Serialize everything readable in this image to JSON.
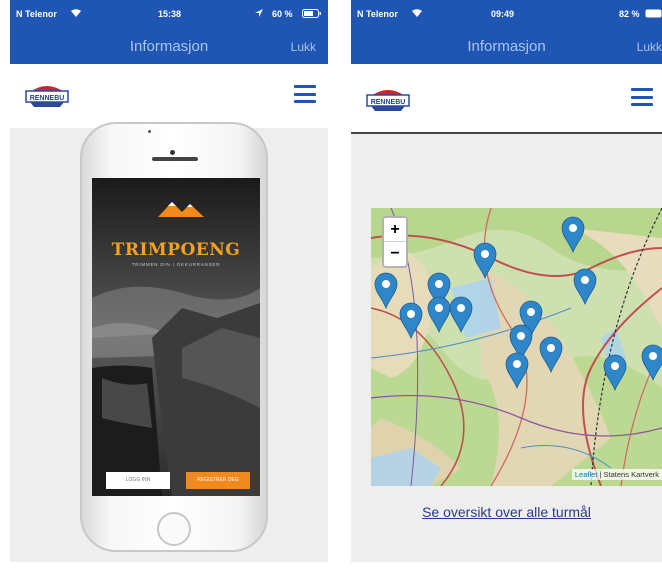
{
  "left": {
    "status": {
      "carrier": "N Telenor",
      "time": "15:38",
      "battery": "60 %"
    },
    "header": {
      "title": "Informasjon",
      "close_label": "Lukk"
    },
    "logo_text": "RENNEBU",
    "app": {
      "title": "TRIMPOENG",
      "subtitle": "TRIMMEN DIN I OKKURRANSER",
      "login_label": "LOGG INN",
      "register_label": "REGISTRER DEG",
      "accent": "#f08a1c"
    }
  },
  "right": {
    "status": {
      "carrier": "N Telenor",
      "time": "09:49",
      "battery": "82 %"
    },
    "header": {
      "title": "Informasjon",
      "close_label": "Lukk"
    },
    "logo_text": "RENNEBU",
    "map": {
      "zoom_in": "+",
      "zoom_out": "−",
      "attribution_leaflet": "Leaflet",
      "attribution_source": "| Statens Kartverk",
      "marker_count": 17
    },
    "overview_link": "Se oversikt over alle turmål"
  },
  "colors": {
    "header_bg": "#1f56b3",
    "marker": "#2f86c8",
    "link": "#2c3a8c"
  },
  "icons": [
    "wifi-icon",
    "location-icon",
    "battery-icon",
    "menu-icon",
    "marker-icon"
  ]
}
